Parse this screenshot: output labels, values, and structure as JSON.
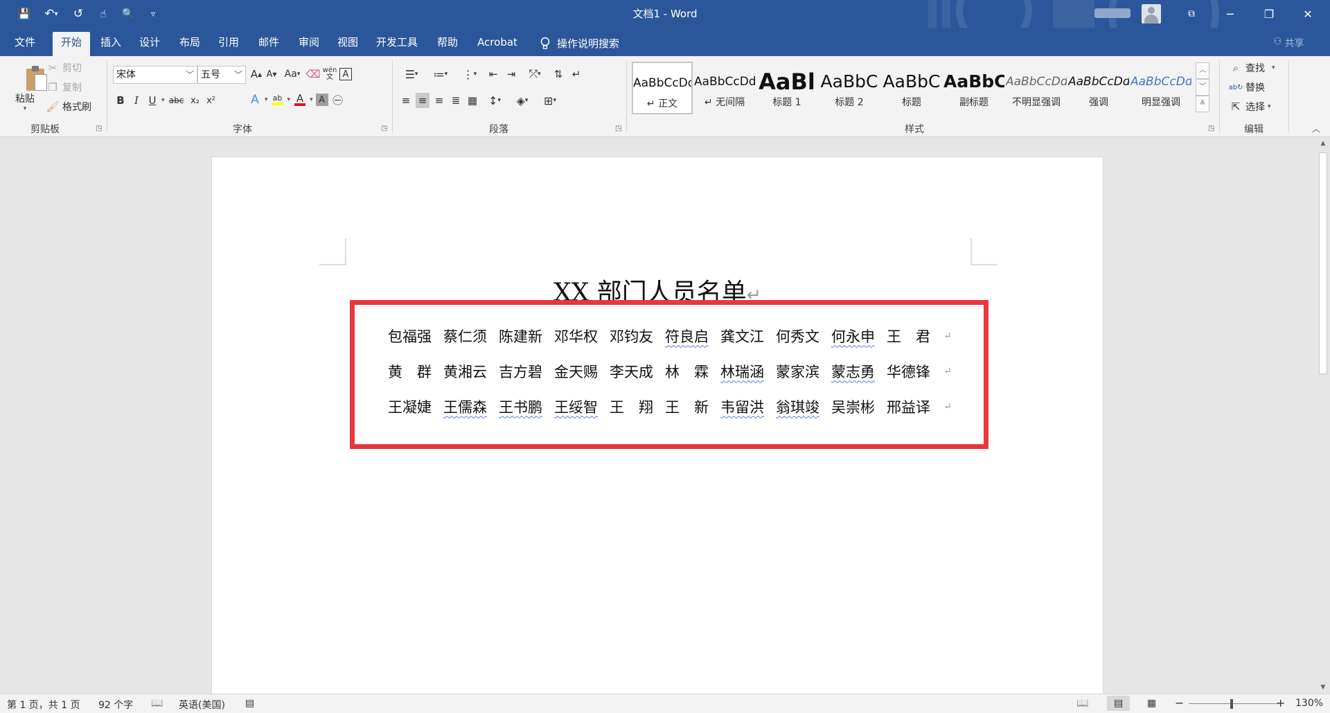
{
  "window": {
    "title": "文档1  -  Word",
    "minimize": "─",
    "restore": "❐",
    "close": "✕",
    "ribbon_display": "⧉"
  },
  "qat": {
    "save": "💾",
    "undo": "↶",
    "undo_arrow": "▾",
    "redo": "↺",
    "touch": "☝",
    "print_preview": "🔍",
    "customize": "▿"
  },
  "tabs": [
    "文件",
    "开始",
    "插入",
    "设计",
    "布局",
    "引用",
    "邮件",
    "审阅",
    "视图",
    "开发工具",
    "帮助",
    "Acrobat"
  ],
  "active_tab": "开始",
  "tell_me": "操作说明搜索",
  "share": "共享",
  "clipboard": {
    "label": "剪贴板",
    "paste": "粘贴",
    "cut": "剪切",
    "copy": "复制",
    "format_painter": "格式刷"
  },
  "font": {
    "label": "字体",
    "family": "宋体",
    "size": "五号",
    "grow": "A",
    "shrink": "A",
    "change_case": "Aa",
    "bold": "B",
    "italic": "I",
    "underline": "U",
    "strike": "abc",
    "subscript": "x₂",
    "superscript": "x²",
    "phonetic": "wén",
    "char_border": "A",
    "text_effect": "A",
    "font_color": "A",
    "char_shading": "A",
    "enclose": "㊀",
    "highlight": "ab"
  },
  "paragraph": {
    "label": "段落"
  },
  "styles": {
    "label": "样式",
    "items": [
      {
        "preview": "AaBbCcDd",
        "name": "↵ 正文"
      },
      {
        "preview": "AaBbCcDd",
        "name": "↵ 无间隔"
      },
      {
        "preview": "AaBl",
        "name": "标题 1"
      },
      {
        "preview": "AaBbC",
        "name": "标题 2"
      },
      {
        "preview": "AaBbC",
        "name": "标题"
      },
      {
        "preview": "AaBbC",
        "name": "副标题"
      },
      {
        "preview": "AaBbCcDd",
        "name": "不明显强调"
      },
      {
        "preview": "AaBbCcDd",
        "name": "强调"
      },
      {
        "preview": "AaBbCcDd",
        "name": "明显强调"
      }
    ]
  },
  "editing": {
    "label": "编辑",
    "find": "查找",
    "replace": "替换",
    "select": "选择"
  },
  "document": {
    "title": "XX 部门人员名单",
    "rows": [
      [
        "包福强",
        "蔡仁须",
        "陈建新",
        "邓华权",
        "邓钧友",
        "符良启",
        "龚文江",
        "何秀文",
        "何永申",
        "王　君"
      ],
      [
        "黄　群",
        "黄湘云",
        "吉方碧",
        "金天赐",
        "李天成",
        "林　霖",
        "林瑞涵",
        "蒙家滨",
        "蒙志勇",
        "华德锋"
      ],
      [
        "王凝婕",
        "王儒森",
        "王书鹏",
        "王绥智",
        "王　翔",
        "王　新",
        "韦留洪",
        "翁琪竣",
        "吴崇彬",
        "邢益译"
      ]
    ],
    "squiggly": [
      [
        false,
        false,
        false,
        false,
        false,
        true,
        false,
        false,
        true,
        false
      ],
      [
        false,
        false,
        false,
        false,
        false,
        false,
        true,
        false,
        true,
        false
      ],
      [
        false,
        true,
        true,
        true,
        false,
        false,
        true,
        true,
        false,
        false
      ]
    ],
    "para_mark": "↵"
  },
  "status": {
    "page": "第 1 页，共 1 页",
    "words": "92 个字",
    "language": "英语(美国)",
    "zoom": "130%",
    "zoom_minus": "−",
    "zoom_plus": "+"
  },
  "colors": {
    "brand": "#2b579a",
    "highlight_box": "#e8373e",
    "font_color_bar": "#e81123",
    "highlight_color_bar": "#ffff00"
  }
}
